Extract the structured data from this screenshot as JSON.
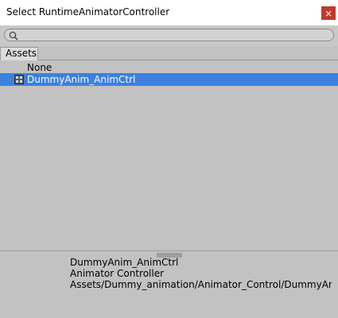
{
  "window": {
    "title": "Select RuntimeAnimatorController",
    "close_glyph": "×"
  },
  "search": {
    "value": "",
    "placeholder": ""
  },
  "tabs": [
    {
      "label": "Assets",
      "selected": true
    }
  ],
  "list": {
    "items": [
      {
        "label": "None",
        "icon": null,
        "selected": false
      },
      {
        "label": "DummyAnim_AnimCtrl",
        "icon": "animator-controller-icon",
        "selected": true
      }
    ]
  },
  "preview": {
    "name": "DummyAnim_AnimCtrl",
    "type": "Animator Controller",
    "path": "Assets/Dummy_animation/Animator_Control/DummyAnimCtrl.controller"
  },
  "colors": {
    "selection": "#3d80df",
    "close_button": "#c0392b",
    "background": "#c2c2c2"
  }
}
